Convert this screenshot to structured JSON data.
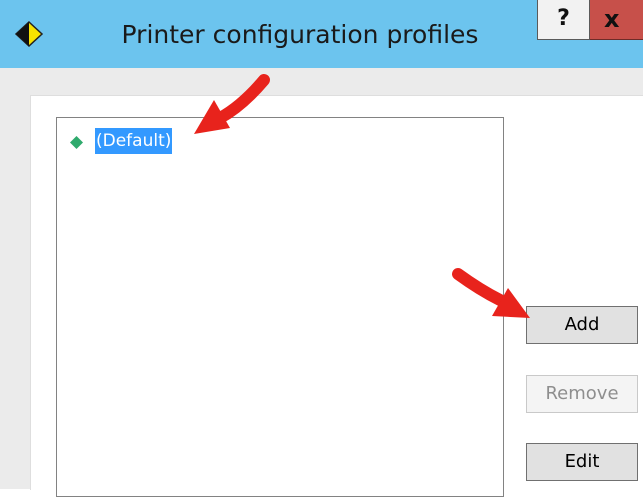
{
  "window": {
    "title": "Printer configuration profiles",
    "help_label": "?",
    "close_label": "x"
  },
  "profiles": {
    "items": [
      {
        "label": "(Default)",
        "selected": true
      }
    ]
  },
  "buttons": {
    "add": "Add",
    "remove": "Remove",
    "edit": "Edit"
  },
  "colors": {
    "titlebar": "#6cc4ee",
    "selection": "#3399ff",
    "item_icon": "#2faa6d",
    "annotation_arrow": "#e8231c"
  }
}
